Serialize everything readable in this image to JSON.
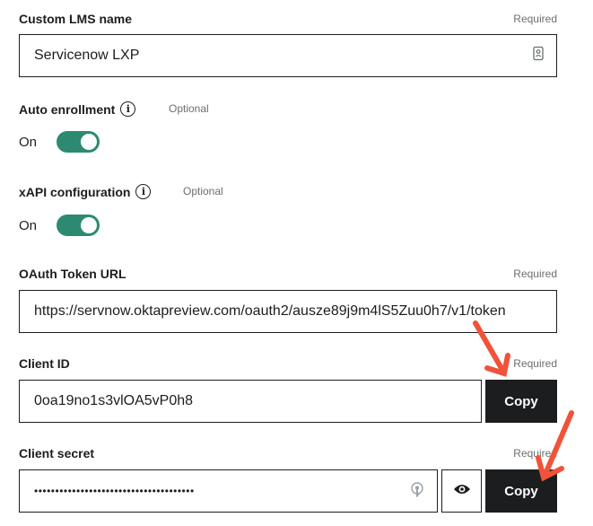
{
  "custom_lms": {
    "label": "Custom LMS name",
    "required": "Required",
    "value": "Servicenow LXP",
    "end_icon": "contact-card-icon"
  },
  "auto_enrollment": {
    "label": "Auto enrollment",
    "optional": "Optional",
    "state": "On",
    "info_icon": "info-icon"
  },
  "xapi": {
    "label": "xAPI configuration",
    "optional": "Optional",
    "state": "On",
    "info_icon": "info-icon"
  },
  "oauth": {
    "label": "OAuth Token URL",
    "required": "Required",
    "value": "https://servnow.oktapreview.com/oauth2/ausze89j9m4lS5Zuu0h7/v1/token"
  },
  "client_id": {
    "label": "Client ID",
    "required": "Required",
    "value": "0oa19no1s3vlOA5vP0h8",
    "copy_label": "Copy"
  },
  "client_secret": {
    "label": "Client secret",
    "required": "Required",
    "value": "••••••••••••••••••••••••••••••••••••••",
    "copy_label": "Copy",
    "eye_icon": "eye-icon",
    "end_icon": "key-icon"
  },
  "colors": {
    "toggle_on": "#2d8a71",
    "button_dark": "#1c1d1f",
    "annotation_arrow": "#f0533a"
  }
}
